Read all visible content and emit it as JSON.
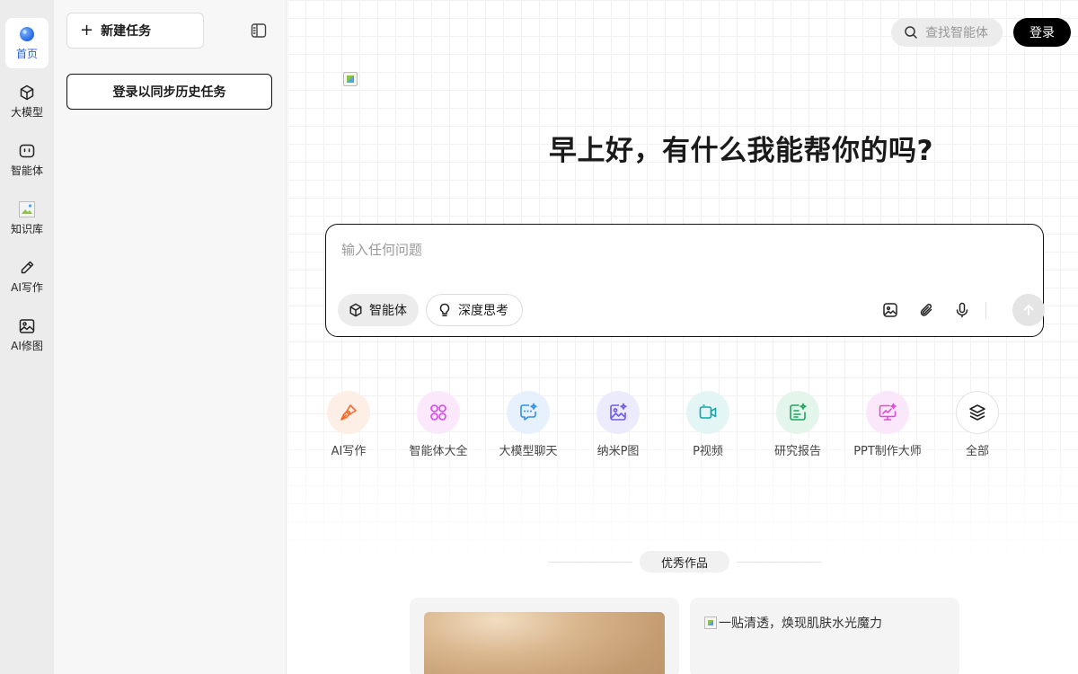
{
  "rail": {
    "items": [
      {
        "label": "首页",
        "icon": "home-icon"
      },
      {
        "label": "大模型",
        "icon": "cube-icon"
      },
      {
        "label": "智能体",
        "icon": "agent-icon"
      },
      {
        "label": "知识库",
        "icon": "knowledge-icon"
      },
      {
        "label": "AI写作",
        "icon": "pen-icon"
      },
      {
        "label": "AI修图",
        "icon": "image-icon"
      }
    ]
  },
  "panel": {
    "new_task": "新建任务",
    "login_sync": "登录以同步历史任务"
  },
  "header": {
    "search_placeholder": "查找智能体",
    "login": "登录"
  },
  "main": {
    "greeting": "早上好，有什么我能帮你的吗?",
    "composer": {
      "placeholder": "输入任何问题",
      "chip_agent": "智能体",
      "chip_think": "深度思考"
    },
    "shortcuts": [
      {
        "label": "AI写作",
        "icon": "pen-nib-icon",
        "color": "#f26b2b",
        "bg": "#fdeee6"
      },
      {
        "label": "智能体大全",
        "icon": "grid-circles-icon",
        "color": "#d946ef",
        "bg": "#fbe9fb"
      },
      {
        "label": "大模型聊天",
        "icon": "chat-sparkle-icon",
        "color": "#2f8ff0",
        "bg": "#e6f1fd"
      },
      {
        "label": "纳米P图",
        "icon": "photo-sparkle-icon",
        "color": "#6d5ce8",
        "bg": "#ecebfb"
      },
      {
        "label": "P视频",
        "icon": "video-icon",
        "color": "#14a3a8",
        "bg": "#e3f5f5"
      },
      {
        "label": "研究报告",
        "icon": "report-icon",
        "color": "#1fa45e",
        "bg": "#e4f5eb"
      },
      {
        "label": "PPT制作大师",
        "icon": "presentation-icon",
        "color": "#e04bd9",
        "bg": "#fbe7fa"
      },
      {
        "label": "全部",
        "icon": "layers-icon",
        "color": "#222222",
        "bg": "#ffffff"
      }
    ],
    "showcase_title": "优秀作品",
    "showcase_card2_caption": "一贴清透，焕现肌肤水光魔力"
  }
}
